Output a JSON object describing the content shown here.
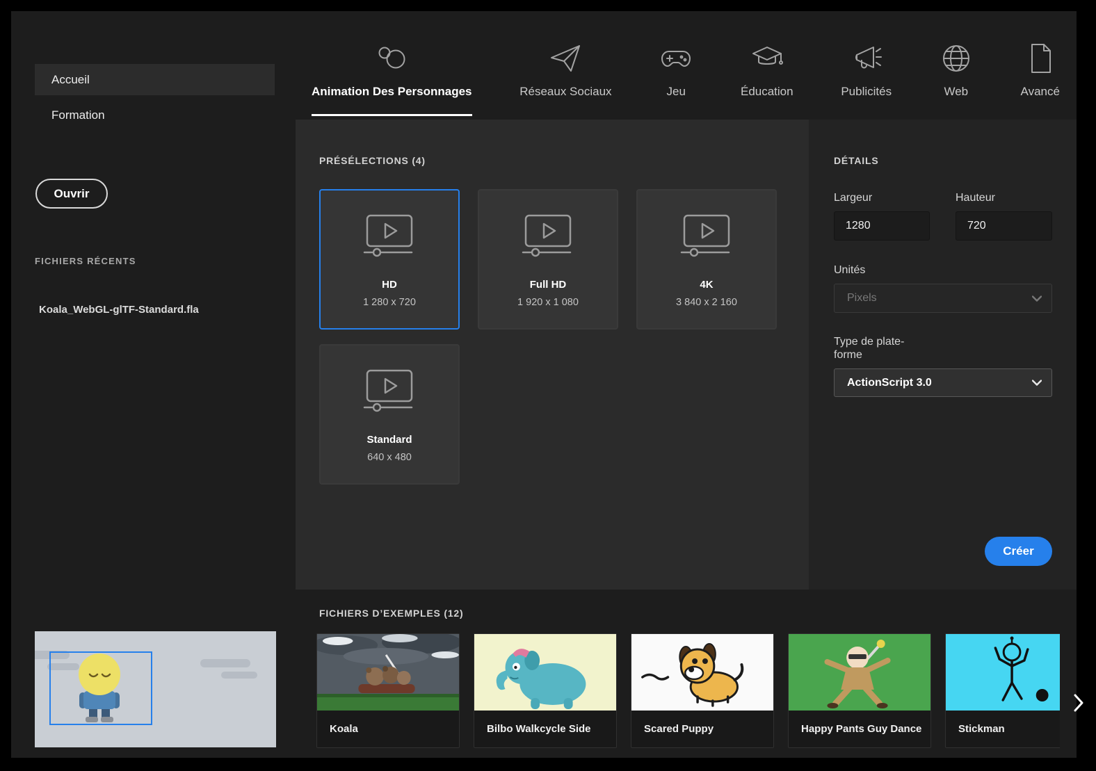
{
  "sidebar": {
    "nav": [
      {
        "label": "Accueil",
        "active": true
      },
      {
        "label": "Formation",
        "active": false
      }
    ],
    "open_button": "Ouvrir",
    "recent_header": "FICHIERS RÉCENTS",
    "recent_files": [
      {
        "name": "Koala_WebGL-glTF-Standard.fla"
      }
    ]
  },
  "tabs": [
    {
      "label": "Animation Des Personnages",
      "icon": "character-animation-icon",
      "active": true
    },
    {
      "label": "Réseaux Sociaux",
      "icon": "paper-plane-icon",
      "active": false
    },
    {
      "label": "Jeu",
      "icon": "gamepad-icon",
      "active": false
    },
    {
      "label": "Éducation",
      "icon": "graduation-cap-icon",
      "active": false
    },
    {
      "label": "Publicités",
      "icon": "megaphone-icon",
      "active": false
    },
    {
      "label": "Web",
      "icon": "globe-icon",
      "active": false
    },
    {
      "label": "Avancé",
      "icon": "document-icon",
      "active": false
    }
  ],
  "presets": {
    "header": "PRÉSÉLECTIONS (4)",
    "items": [
      {
        "name": "HD",
        "size": "1 280 x 720",
        "selected": true
      },
      {
        "name": "Full HD",
        "size": "1 920 x 1 080",
        "selected": false
      },
      {
        "name": "4K",
        "size": "3 840 x 2 160",
        "selected": false
      },
      {
        "name": "Standard",
        "size": "640 x 480",
        "selected": false
      }
    ]
  },
  "details": {
    "header": "DÉTAILS",
    "width": {
      "label": "Largeur",
      "value": "1280"
    },
    "height": {
      "label": "Hauteur",
      "value": "720"
    },
    "units": {
      "label": "Unités",
      "value": "Pixels"
    },
    "platform": {
      "label": "Type de plate-forme",
      "value": "ActionScript 3.0"
    },
    "create_button": "Créer"
  },
  "samples": {
    "header": "FICHIERS D’EXEMPLES (12)",
    "items": [
      {
        "name": "Koala"
      },
      {
        "name": "Bilbo Walkcycle Side"
      },
      {
        "name": "Scared Puppy"
      },
      {
        "name": "Happy Pants Guy Dance"
      },
      {
        "name": "Stickman"
      }
    ]
  },
  "colors": {
    "accent_blue": "#2680eb",
    "background": "#1d1d1d",
    "panel": "#2b2b2b",
    "panel_right": "#232323"
  }
}
